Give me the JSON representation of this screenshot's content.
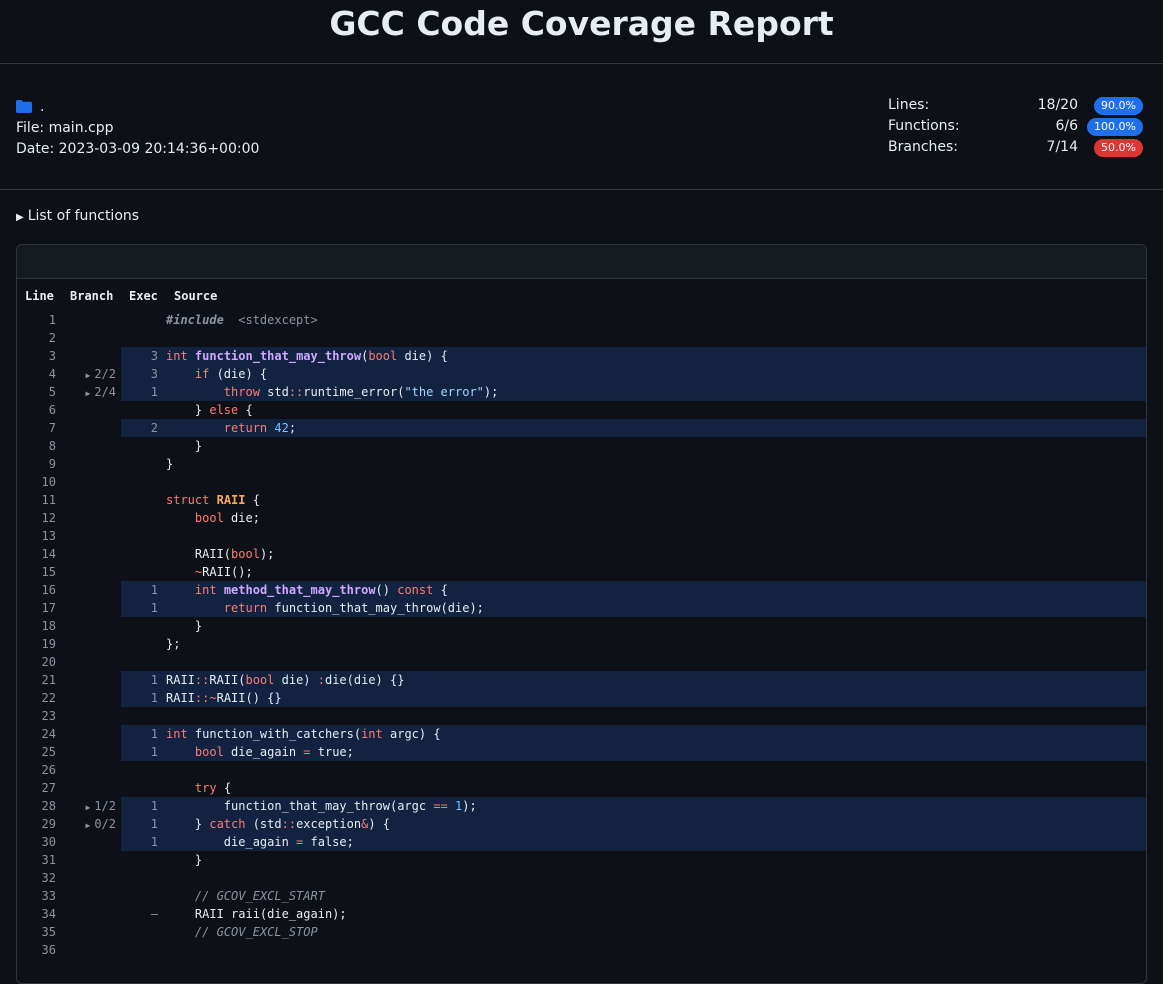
{
  "page_title": "GCC Code Coverage Report",
  "info": {
    "directory": ".",
    "file": "File: main.cpp",
    "date": "Date: 2023-03-09 20:14:36+00:00"
  },
  "stats": [
    {
      "label": "Lines:",
      "value": "18/20",
      "percent": "90.0%",
      "level": "good"
    },
    {
      "label": "Functions:",
      "value": "6/6",
      "percent": "100.0%",
      "level": "good"
    },
    {
      "label": "Branches:",
      "value": "7/14",
      "percent": "50.0%",
      "level": "bad"
    }
  ],
  "function_list_label": "List of functions",
  "columns": {
    "line": "Line",
    "branch": "Branch",
    "exec": "Exec",
    "source": "Source"
  },
  "colors": {
    "covered_row": "#112341",
    "badge_good": "#1f6feb",
    "badge_bad": "#da3633"
  },
  "lines": [
    {
      "n": "1",
      "br": "",
      "ex": "",
      "src": [
        [
          "pp",
          "#include"
        ],
        [
          "",
          "  "
        ],
        [
          "inc",
          "<stdexcept>"
        ]
      ]
    },
    {
      "n": "2",
      "br": "",
      "ex": "",
      "src": []
    },
    {
      "n": "3",
      "br": "",
      "ex": "3",
      "src": [
        [
          "kw",
          "int"
        ],
        [
          "",
          " "
        ],
        [
          "fn",
          "function_that_may_throw"
        ],
        [
          "",
          "("
        ],
        [
          "kw",
          "bool"
        ],
        [
          "",
          " die) {"
        ]
      ]
    },
    {
      "n": "4",
      "br": "2/2",
      "ex": "3",
      "src": [
        [
          "",
          "    "
        ],
        [
          "kw",
          "if"
        ],
        [
          "",
          " (die) {"
        ]
      ]
    },
    {
      "n": "5",
      "br": "2/4",
      "ex": "1",
      "src": [
        [
          "",
          "        "
        ],
        [
          "kw",
          "throw"
        ],
        [
          "",
          " std"
        ],
        [
          "kw",
          "::"
        ],
        [
          "",
          "runtime_error("
        ],
        [
          "str",
          "\"the error\""
        ],
        [
          "",
          ");"
        ]
      ]
    },
    {
      "n": "6",
      "br": "",
      "ex": "",
      "src": [
        [
          "",
          "    } "
        ],
        [
          "kw",
          "else"
        ],
        [
          "",
          " {"
        ]
      ]
    },
    {
      "n": "7",
      "br": "",
      "ex": "2",
      "src": [
        [
          "",
          "        "
        ],
        [
          "kw",
          "return"
        ],
        [
          "",
          " "
        ],
        [
          "num",
          "42"
        ],
        [
          "",
          ";"
        ]
      ]
    },
    {
      "n": "8",
      "br": "",
      "ex": "",
      "src": [
        [
          "",
          "    }"
        ]
      ]
    },
    {
      "n": "9",
      "br": "",
      "ex": "",
      "src": [
        [
          "",
          "}"
        ]
      ]
    },
    {
      "n": "10",
      "br": "",
      "ex": "",
      "src": []
    },
    {
      "n": "11",
      "br": "",
      "ex": "",
      "src": [
        [
          "kw",
          "struct"
        ],
        [
          "",
          " "
        ],
        [
          "ty",
          "RAII"
        ],
        [
          "",
          " {"
        ]
      ]
    },
    {
      "n": "12",
      "br": "",
      "ex": "",
      "src": [
        [
          "",
          "    "
        ],
        [
          "kw",
          "bool"
        ],
        [
          "",
          " die;"
        ]
      ]
    },
    {
      "n": "13",
      "br": "",
      "ex": "",
      "src": []
    },
    {
      "n": "14",
      "br": "",
      "ex": "",
      "src": [
        [
          "",
          "    RAII("
        ],
        [
          "kw",
          "bool"
        ],
        [
          "",
          ");"
        ]
      ]
    },
    {
      "n": "15",
      "br": "",
      "ex": "",
      "src": [
        [
          "",
          "    "
        ],
        [
          "kw",
          "~"
        ],
        [
          "",
          "RAII();"
        ]
      ]
    },
    {
      "n": "16",
      "br": "",
      "ex": "1",
      "src": [
        [
          "",
          "    "
        ],
        [
          "kw",
          "int"
        ],
        [
          "",
          " "
        ],
        [
          "fn",
          "method_that_may_throw"
        ],
        [
          "",
          "() "
        ],
        [
          "kw",
          "const"
        ],
        [
          "",
          " {"
        ]
      ]
    },
    {
      "n": "17",
      "br": "",
      "ex": "1",
      "src": [
        [
          "",
          "        "
        ],
        [
          "kw",
          "return"
        ],
        [
          "",
          " function_that_may_throw(die);"
        ]
      ]
    },
    {
      "n": "18",
      "br": "",
      "ex": "",
      "src": [
        [
          "",
          "    }"
        ]
      ]
    },
    {
      "n": "19",
      "br": "",
      "ex": "",
      "src": [
        [
          "",
          "};"
        ]
      ]
    },
    {
      "n": "20",
      "br": "",
      "ex": "",
      "src": []
    },
    {
      "n": "21",
      "br": "",
      "ex": "1",
      "src": [
        [
          "",
          "RAII"
        ],
        [
          "kw",
          "::"
        ],
        [
          "",
          "RAII("
        ],
        [
          "kw",
          "bool"
        ],
        [
          "",
          " die) "
        ],
        [
          "kw",
          ":"
        ],
        [
          "",
          "die(die) {}"
        ]
      ]
    },
    {
      "n": "22",
      "br": "",
      "ex": "1",
      "src": [
        [
          "",
          "RAII"
        ],
        [
          "kw",
          "::~"
        ],
        [
          "",
          "RAII() {}"
        ]
      ]
    },
    {
      "n": "23",
      "br": "",
      "ex": "",
      "src": []
    },
    {
      "n": "24",
      "br": "",
      "ex": "1",
      "src": [
        [
          "kw",
          "int"
        ],
        [
          "",
          " function_with_catchers("
        ],
        [
          "kw",
          "int"
        ],
        [
          "",
          " argc) {"
        ]
      ]
    },
    {
      "n": "25",
      "br": "",
      "ex": "1",
      "src": [
        [
          "",
          "    "
        ],
        [
          "kw",
          "bool"
        ],
        [
          "",
          " die_again "
        ],
        [
          "kw",
          "="
        ],
        [
          "",
          " true;"
        ]
      ]
    },
    {
      "n": "26",
      "br": "",
      "ex": "",
      "src": []
    },
    {
      "n": "27",
      "br": "",
      "ex": "",
      "src": [
        [
          "",
          "    "
        ],
        [
          "kw",
          "try"
        ],
        [
          "",
          " {"
        ]
      ]
    },
    {
      "n": "28",
      "br": "1/2",
      "ex": "1",
      "src": [
        [
          "",
          "        function_that_may_throw(argc "
        ],
        [
          "kw",
          "=="
        ],
        [
          "",
          " "
        ],
        [
          "num",
          "1"
        ],
        [
          "",
          ");"
        ]
      ]
    },
    {
      "n": "29",
      "br": "0/2",
      "ex": "1",
      "src": [
        [
          "",
          "    } "
        ],
        [
          "kw",
          "catch"
        ],
        [
          "",
          " (std"
        ],
        [
          "kw",
          "::"
        ],
        [
          "",
          "exception"
        ],
        [
          "kw",
          "&"
        ],
        [
          "",
          ") {"
        ]
      ]
    },
    {
      "n": "30",
      "br": "",
      "ex": "1",
      "src": [
        [
          "",
          "        die_again "
        ],
        [
          "kw",
          "="
        ],
        [
          "",
          " false;"
        ]
      ]
    },
    {
      "n": "31",
      "br": "",
      "ex": "",
      "src": [
        [
          "",
          "    }"
        ]
      ]
    },
    {
      "n": "32",
      "br": "",
      "ex": "",
      "src": []
    },
    {
      "n": "33",
      "br": "",
      "ex": "",
      "src": [
        [
          "",
          "    "
        ],
        [
          "cm",
          "// GCOV_EXCL_START"
        ]
      ]
    },
    {
      "n": "34",
      "br": "",
      "ex": "–",
      "src": [
        [
          "",
          "    RAII raii(die_again);"
        ]
      ]
    },
    {
      "n": "35",
      "br": "",
      "ex": "",
      "src": [
        [
          "",
          "    "
        ],
        [
          "cm",
          "// GCOV_EXCL_STOP"
        ]
      ]
    },
    {
      "n": "36",
      "br": "",
      "ex": "",
      "src": []
    }
  ]
}
